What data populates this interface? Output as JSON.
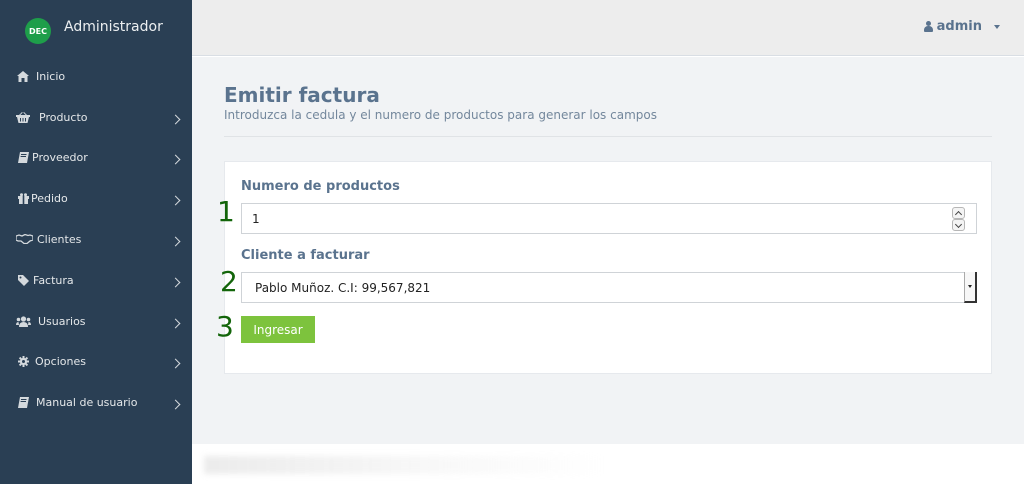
{
  "sidebar": {
    "brand_logo_text": "DEC",
    "brand_title": "Administrador",
    "items": [
      {
        "label": "Inicio",
        "icon": "home-icon",
        "has_submenu": false
      },
      {
        "label": "Producto",
        "icon": "basket-icon",
        "has_submenu": true
      },
      {
        "label": "Proveedor",
        "icon": "book-icon",
        "has_submenu": true
      },
      {
        "label": "Pedido",
        "icon": "gift-icon",
        "has_submenu": true
      },
      {
        "label": "Clientes",
        "icon": "handshake-icon",
        "has_submenu": true
      },
      {
        "label": "Factura",
        "icon": "tag-icon",
        "has_submenu": true
      },
      {
        "label": "Usuarios",
        "icon": "users-icon",
        "has_submenu": true
      },
      {
        "label": "Opciones",
        "icon": "gear-icon",
        "has_submenu": true
      },
      {
        "label": "Manual de usuario",
        "icon": "book-icon",
        "has_submenu": true
      }
    ]
  },
  "topbar": {
    "user_name": "admin",
    "user_icon": "user-icon"
  },
  "page": {
    "title": "Emitir factura",
    "subtitle": "Introduzca la cedula y el numero de productos para generar los campos"
  },
  "form": {
    "quantity_label": "Numero de productos",
    "quantity_value": "1",
    "client_label": "Cliente a facturar",
    "client_selected": "Pablo Muñoz. C.I: 99,567,821",
    "submit_label": "Ingresar"
  },
  "markers": [
    "1",
    "2",
    "3"
  ],
  "colors": {
    "sidebar_bg": "#2a3f54",
    "accent_green": "#7dc33d",
    "marker_green": "#13650a",
    "text_primary": "#5a738e"
  }
}
